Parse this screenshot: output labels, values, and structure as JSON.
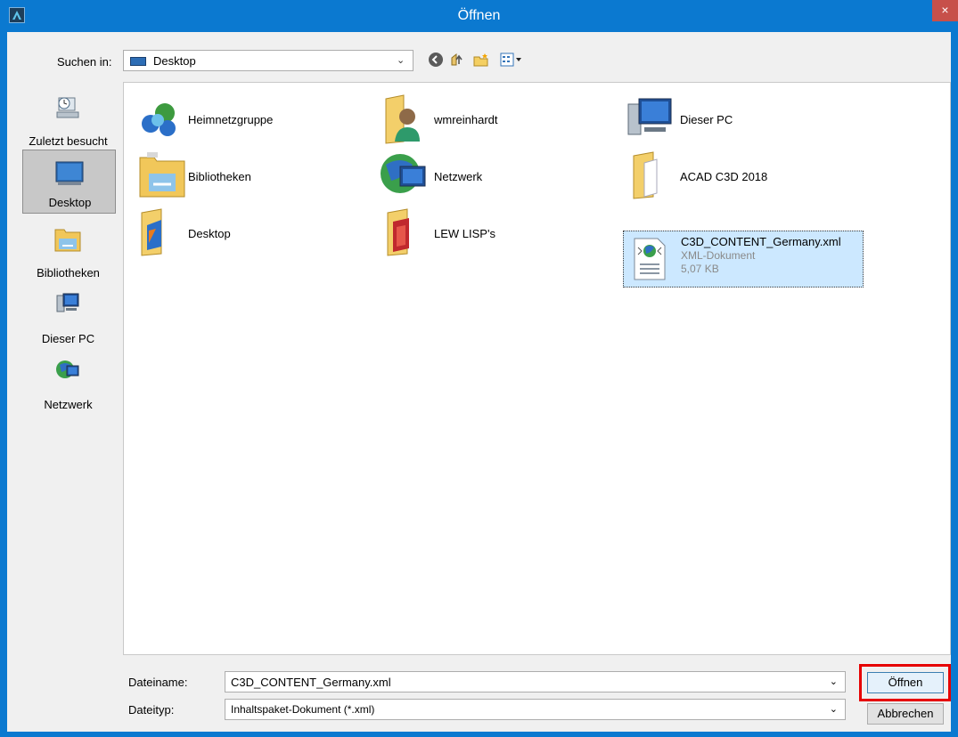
{
  "window": {
    "title": "Öffnen",
    "close_glyph": "×",
    "app_icon": "autocad-icon"
  },
  "toolbar": {
    "lookin_label": "Suchen in:",
    "lookin_value": "Desktop",
    "buttons": [
      "back-icon",
      "up-folder-icon",
      "new-folder-icon",
      "view-menu-icon"
    ]
  },
  "places": [
    {
      "label": "Zuletzt besucht",
      "icon": "recent-places-icon"
    },
    {
      "label": "Desktop",
      "icon": "desktop-icon",
      "selected": true
    },
    {
      "label": "Bibliotheken",
      "icon": "libraries-icon"
    },
    {
      "label": "Dieser PC",
      "icon": "computer-icon"
    },
    {
      "label": "Netzwerk",
      "icon": "network-icon"
    }
  ],
  "files": [
    {
      "name": "Heimnetzgruppe",
      "icon": "homegroup-icon"
    },
    {
      "name": "wmreinhardt",
      "icon": "user-folder-icon"
    },
    {
      "name": "Dieser PC",
      "icon": "computer-icon"
    },
    {
      "name": "Bibliotheken",
      "icon": "libraries-icon"
    },
    {
      "name": "Netzwerk",
      "icon": "network-icon"
    },
    {
      "name": "ACAD C3D 2018",
      "icon": "folder-icon"
    },
    {
      "name": "Desktop",
      "icon": "folder-icon"
    },
    {
      "name": "LEW LISP's",
      "icon": "folder-icon"
    },
    {
      "name": "C3D_CONTENT_Germany.xml",
      "type": "XML-Dokument",
      "size": "5,07 KB",
      "icon": "xml-file-icon",
      "selected": true
    }
  ],
  "footer": {
    "filename_label": "Dateiname:",
    "filename_value": "C3D_CONTENT_Germany.xml",
    "filetype_label": "Dateityp:",
    "filetype_value": "Inhaltspaket-Dokument (*.xml)",
    "open_label": "Öffnen",
    "cancel_label": "Abbrechen"
  },
  "colors": {
    "titlebar": "#0b79d0",
    "close": "#c7504a",
    "highlight": "#e60000",
    "selection": "#cce8ff"
  }
}
